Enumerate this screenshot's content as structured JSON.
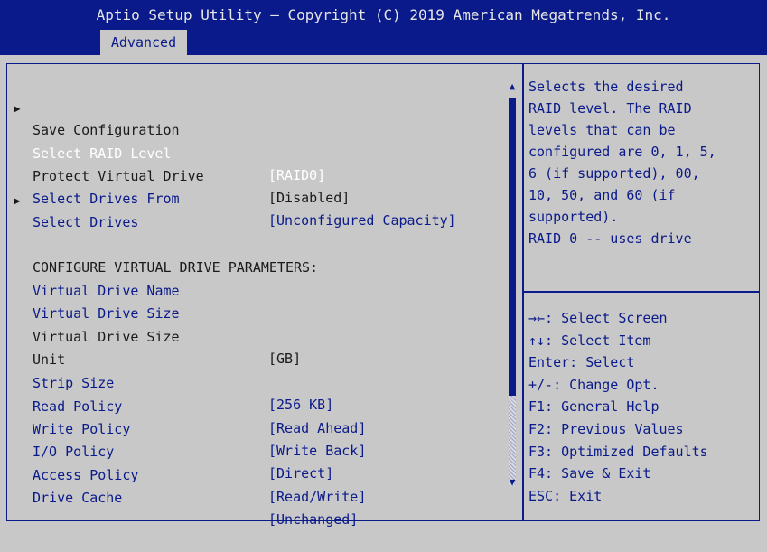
{
  "header": {
    "title": "Aptio Setup Utility – Copyright (C) 2019 American Megatrends, Inc.",
    "tab_active": "Advanced"
  },
  "menu": {
    "items": [
      {
        "arrow": "▶",
        "label": "Save Configuration",
        "value": "",
        "style": "dark"
      },
      {
        "arrow": "",
        "label": "Select RAID Level",
        "value": "[RAID0]",
        "style": "white"
      },
      {
        "arrow": "",
        "label": "Protect Virtual Drive",
        "value": "[Disabled]",
        "style": "dark"
      },
      {
        "arrow": "",
        "label": "Select Drives From",
        "value": "[Unconfigured Capacity]",
        "style": "blue"
      },
      {
        "arrow": "▶",
        "label": "Select Drives",
        "value": "",
        "style": "blue"
      },
      {
        "arrow": "",
        "label": "CONFIGURE VIRTUAL DRIVE PARAMETERS:",
        "value": "",
        "style": "dark"
      },
      {
        "arrow": "",
        "label": "Virtual Drive Name",
        "value": "",
        "style": "blue"
      },
      {
        "arrow": "",
        "label": "Virtual Drive Size",
        "value": "",
        "style": "blue"
      },
      {
        "arrow": "",
        "label": "Virtual Drive Size",
        "value": "[GB]",
        "style": "dark"
      },
      {
        "arrow": "",
        "label": "Unit",
        "value": "",
        "style": "dark"
      },
      {
        "arrow": "",
        "label": "Strip Size",
        "value": "[256 KB]",
        "style": "blue"
      },
      {
        "arrow": "",
        "label": "Read Policy",
        "value": "[Read Ahead]",
        "style": "blue"
      },
      {
        "arrow": "",
        "label": "Write Policy",
        "value": "[Write Back]",
        "style": "blue"
      },
      {
        "arrow": "",
        "label": "I/O Policy",
        "value": "[Direct]",
        "style": "blue"
      },
      {
        "arrow": "",
        "label": "Access Policy",
        "value": "[Read/Write]",
        "style": "blue"
      },
      {
        "arrow": "",
        "label": "Drive Cache",
        "value": "[Unchanged]",
        "style": "blue"
      }
    ]
  },
  "scrollbar": {
    "up_glyph": "▲",
    "down_glyph": "▼"
  },
  "help": {
    "lines": [
      "Selects the desired",
      "RAID level. The RAID",
      "levels that can be",
      "configured are 0, 1, 5,",
      "6 (if supported), 00,",
      "10, 50, and 60 (if",
      "supported).",
      "RAID 0 -- uses drive"
    ]
  },
  "keys": {
    "lines": [
      "→←: Select Screen",
      "↑↓: Select Item",
      "Enter: Select",
      "+/-: Change Opt.",
      "F1: General Help",
      "F2: Previous Values",
      "F3: Optimized Defaults",
      "F4: Save & Exit",
      "ESC: Exit"
    ]
  },
  "colors": {
    "header_bg": "#0a1a8a",
    "panel_bg": "#c8c8c8",
    "accent_blue": "#0a1a8a",
    "selected_text": "#ffffff"
  }
}
